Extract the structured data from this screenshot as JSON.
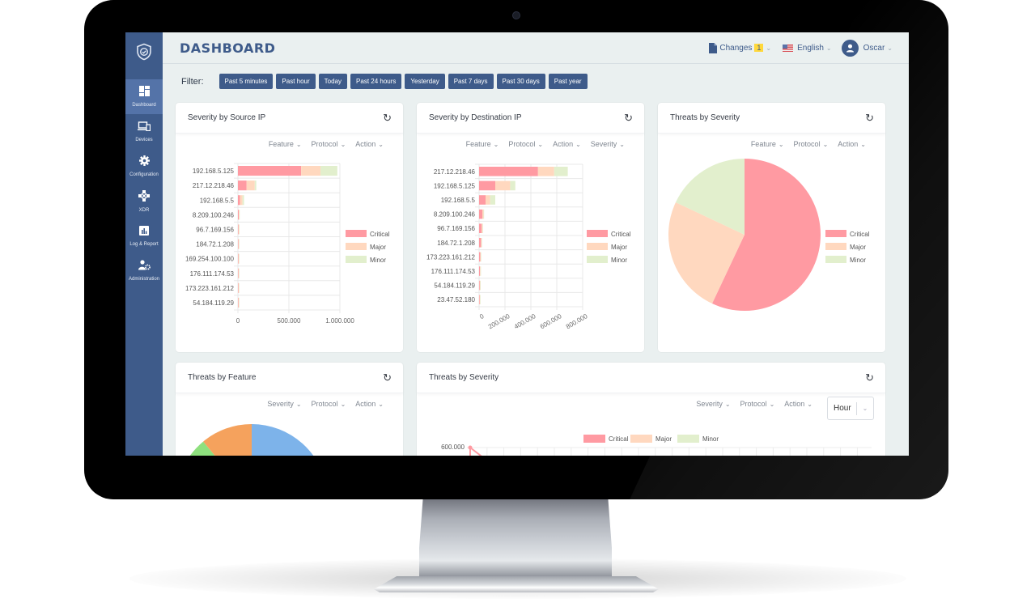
{
  "app": {
    "page_title": "DASHBOARD",
    "logo_icon": "shield-check-icon"
  },
  "sidebar": {
    "items": [
      {
        "label": "Dashboard",
        "icon": "dashboard-grid-icon",
        "active": true
      },
      {
        "label": "Devices",
        "icon": "devices-icon",
        "active": false
      },
      {
        "label": "Configuration",
        "icon": "gear-icon",
        "active": false
      },
      {
        "label": "XDR",
        "icon": "xdr-network-icon",
        "active": false
      },
      {
        "label": "Log & Report",
        "icon": "bar-chart-icon",
        "active": false
      },
      {
        "label": "Administration",
        "icon": "user-gear-icon",
        "active": false
      }
    ]
  },
  "topbar": {
    "changes_label": "Changes",
    "changes_count": "1",
    "language": "English",
    "user": "Oscar"
  },
  "filter": {
    "label": "Filter:",
    "options": [
      "Past 5 minutes",
      "Past hour",
      "Today",
      "Past 24 hours",
      "Yesterday",
      "Past 7 days",
      "Past 30 days",
      "Past year"
    ]
  },
  "colors": {
    "primary": "#3e5b8a",
    "critical": "#ff9aa2",
    "major": "#ffd8bf",
    "minor": "#e2efcd",
    "badge": "#ffd83b"
  },
  "cards": {
    "source_ip": {
      "title": "Severity by Source IP",
      "filters": [
        "Feature",
        "Protocol",
        "Action"
      ]
    },
    "dest_ip": {
      "title": "Severity by Destination IP",
      "filters": [
        "Feature",
        "Protocol",
        "Action",
        "Severity"
      ]
    },
    "threats_severity_pie": {
      "title": "Threats by Severity",
      "filters": [
        "Feature",
        "Protocol",
        "Action"
      ]
    },
    "threats_feature": {
      "title": "Threats by Feature",
      "filters": [
        "Severity",
        "Protocol",
        "Action"
      ]
    },
    "threats_severity_line": {
      "title": "Threats by Severity",
      "filters": [
        "Severity",
        "Protocol",
        "Action"
      ],
      "interval": "Hour"
    }
  },
  "chart_data": [
    {
      "id": "source_ip",
      "type": "bar",
      "orientation": "horizontal",
      "stacked": true,
      "title": "Severity by Source IP",
      "categories": [
        "192.168.5.125",
        "217.12.218.46",
        "192.168.5.5",
        "8.209.100.246",
        "96.7.169.156",
        "184.72.1.208",
        "169.254.100.100",
        "176.111.174.53",
        "173.223.161.212",
        "54.184.119.29"
      ],
      "series": [
        {
          "name": "Critical",
          "values": [
            620000,
            85000,
            20000,
            8000,
            6000,
            5000,
            2000,
            3000,
            2000,
            1000
          ]
        },
        {
          "name": "Major",
          "values": [
            190000,
            80000,
            25000,
            4000,
            3000,
            2000,
            1000,
            1000,
            1000,
            1000
          ]
        },
        {
          "name": "Minor",
          "values": [
            165000,
            15000,
            15000,
            1000,
            1000,
            1000,
            500,
            500,
            500,
            500
          ]
        }
      ],
      "xticks": [
        "0",
        "500.000",
        "1.000.000"
      ],
      "xlim": [
        0,
        1000000
      ],
      "legend": "right",
      "grid": true
    },
    {
      "id": "dest_ip",
      "type": "bar",
      "orientation": "horizontal",
      "stacked": true,
      "title": "Severity by Destination IP",
      "categories": [
        "217.12.218.46",
        "192.168.5.125",
        "192.168.5.5",
        "8.209.100.246",
        "96.7.169.156",
        "184.72.1.208",
        "173.223.161.212",
        "176.111.174.53",
        "54.184.119.29",
        "23.47.52.180"
      ],
      "series": [
        {
          "name": "Critical",
          "values": [
            455000,
            125000,
            50000,
            25000,
            20000,
            15000,
            9000,
            7000,
            5000,
            4000
          ]
        },
        {
          "name": "Major",
          "values": [
            125000,
            115000,
            35000,
            10000,
            7000,
            2000,
            1000,
            1000,
            1000,
            1000
          ]
        },
        {
          "name": "Minor",
          "values": [
            105000,
            40000,
            40000,
            2000,
            1000,
            500,
            500,
            500,
            500,
            500
          ]
        }
      ],
      "xticks": [
        "0",
        "200.000",
        "400.000",
        "600.000",
        "800.000"
      ],
      "xlim": [
        0,
        800000
      ],
      "legend": "right",
      "grid": true
    },
    {
      "id": "threats_severity_pie",
      "type": "pie",
      "title": "Threats by Severity",
      "labels": [
        "Critical",
        "Major",
        "Minor"
      ],
      "values": [
        57,
        25,
        18
      ],
      "legend": "right"
    },
    {
      "id": "threats_feature",
      "type": "pie",
      "title": "Threats by Feature",
      "visible_partial": true,
      "slices": [
        {
          "color": "#7db3ea",
          "value": 70
        },
        {
          "color": "#6aa6e6",
          "value": 8
        },
        {
          "color": "#8ee07e",
          "value": 11
        },
        {
          "color": "#f5a25d",
          "value": 11
        }
      ]
    },
    {
      "id": "threats_severity_line",
      "type": "line",
      "title": "Threats by Severity",
      "legend_entries": [
        "Critical",
        "Major",
        "Minor"
      ],
      "legend": "top",
      "yticks_visible": [
        "600.000"
      ],
      "series": [
        {
          "name": "Critical",
          "values_visible": [
            600000,
            560000
          ]
        }
      ]
    }
  ]
}
